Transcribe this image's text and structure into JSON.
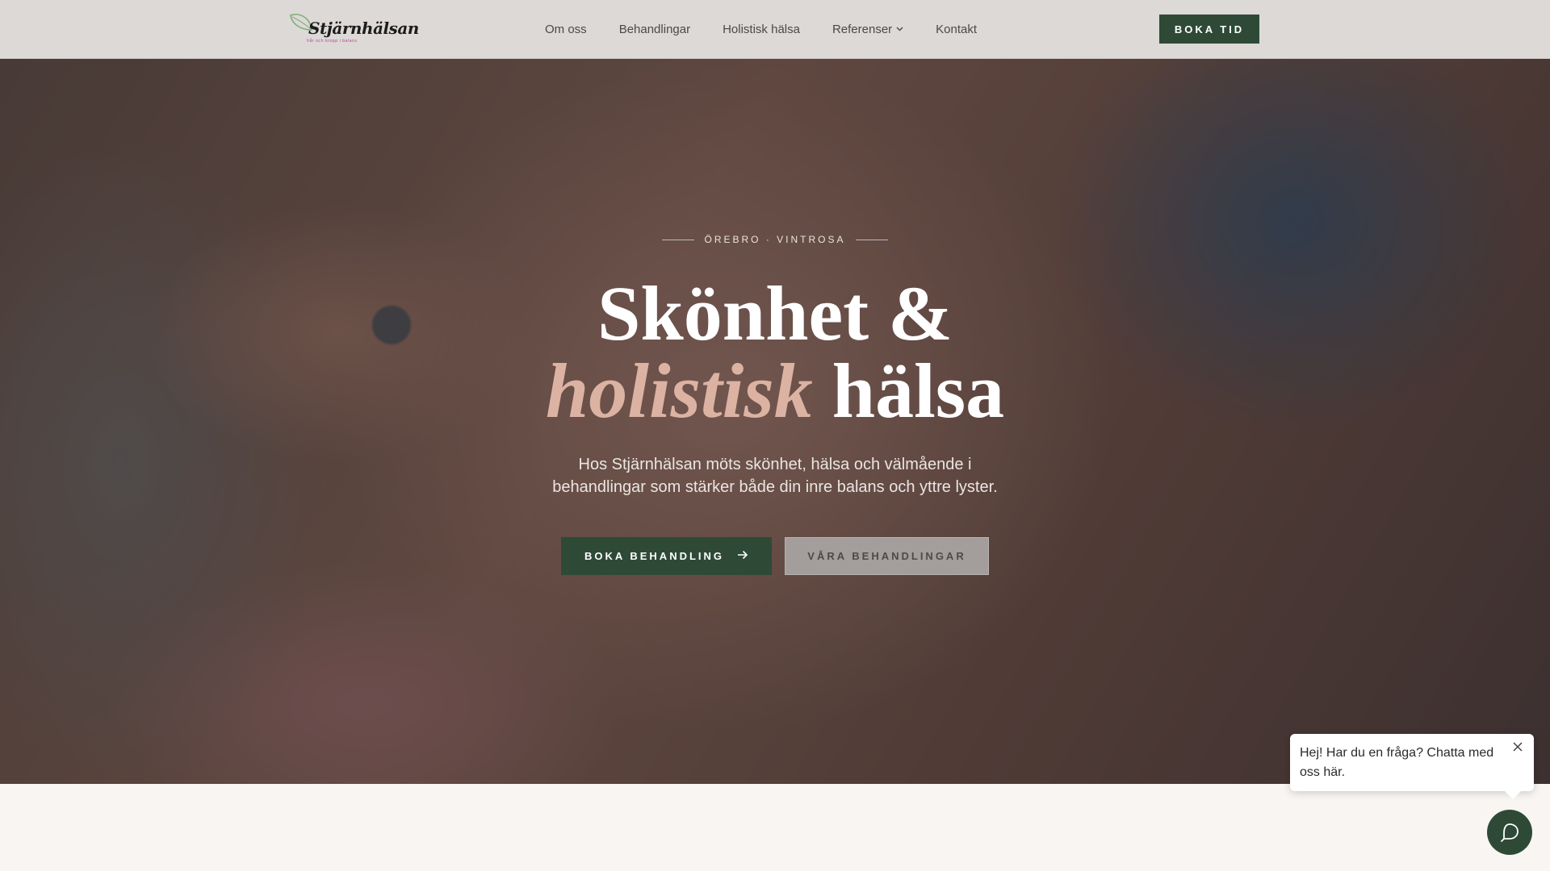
{
  "brand": {
    "logo_text": "Stjärnhälsan",
    "logo_subtext": "hår och kropp i balans"
  },
  "nav": {
    "items": [
      {
        "label": "Om oss"
      },
      {
        "label": "Behandlingar"
      },
      {
        "label": "Holistisk hälsa"
      },
      {
        "label": "Referenser",
        "has_dropdown": true
      },
      {
        "label": "Kontakt"
      }
    ],
    "cta_label": "BOKA TID"
  },
  "hero": {
    "eyebrow": "ÖREBRO · VINTROSA",
    "title_line1": "Skönhet &",
    "title_line2_accent": "holistisk",
    "title_line2_rest": " hälsa",
    "lead": "Hos Stjärnhälsan möts skönhet, hälsa och välmående i behandlingar som stärker både din inre balans och yttre lyster.",
    "primary_button": "BOKA BEHANDLING",
    "secondary_button": "VÅRA BEHANDLINGAR"
  },
  "chat": {
    "message": "Hej! Har du en fråga? Chatta med oss här.",
    "close_icon": "close-icon",
    "launcher_icon": "chat-icon"
  },
  "colors": {
    "accent_green": "#2e4a36",
    "accent_rose": "#dcb3a3",
    "header_bg": "#dcd9d6",
    "page_bg": "#f8f5f2"
  }
}
